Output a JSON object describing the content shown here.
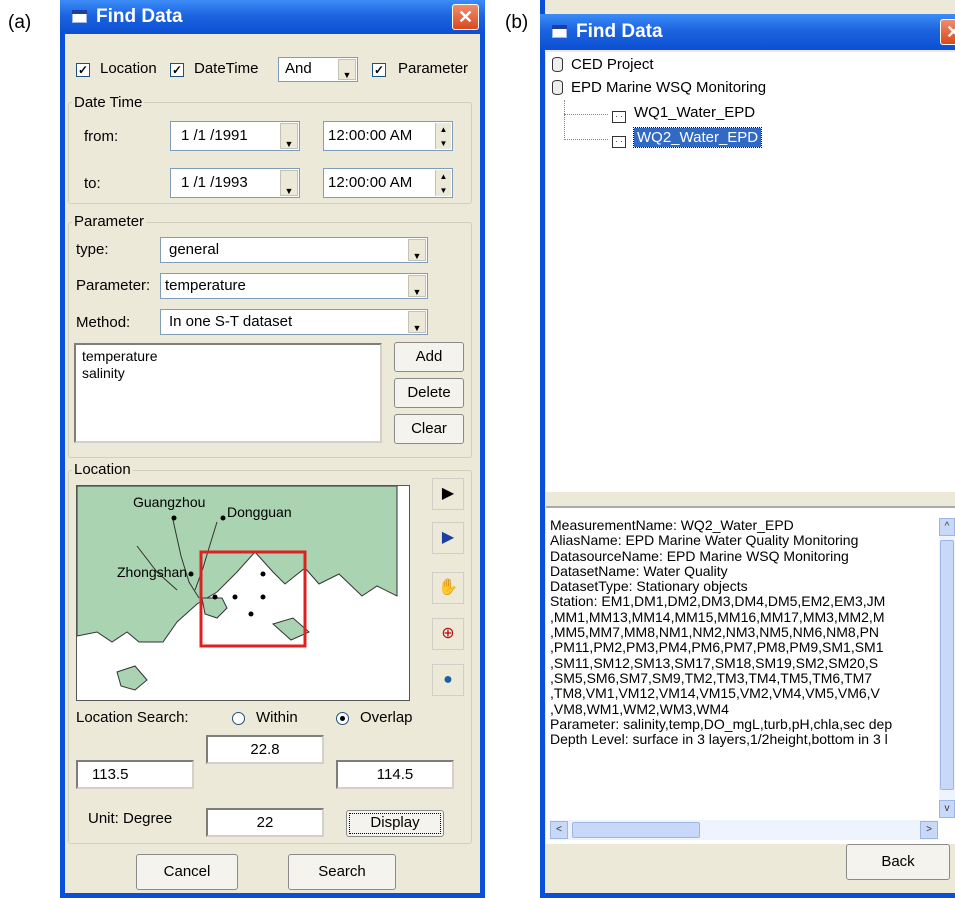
{
  "labels": {
    "a": "(a)",
    "b": "(b)"
  },
  "colors": {
    "title_blue": "#0b4fd2",
    "selection": "#316ac5",
    "map_land": "#a9d3b1",
    "search_box": "#e02020"
  },
  "left_window": {
    "title": "Find Data",
    "filter": {
      "location_label": "Location",
      "location_checked": true,
      "datetime_label": "DateTime",
      "datetime_checked": true,
      "logic_value": "And",
      "parameter_label": "Parameter",
      "parameter_checked": true
    },
    "date_time": {
      "legend": "Date Time",
      "from_label": "from:",
      "from_date": "1 /1 /1991",
      "from_time": "12:00:00 AM",
      "to_label": "to:",
      "to_date": "1 /1 /1993",
      "to_time": "12:00:00 AM"
    },
    "parameter": {
      "legend": "Parameter",
      "type_label": "type:",
      "type_value": "general",
      "parameter_label": "Parameter:",
      "parameter_value": "temperature",
      "method_label": "Method:",
      "method_value": "In one S-T dataset",
      "list": [
        "temperature",
        "salinity"
      ],
      "add_label": "Add",
      "delete_label": "Delete",
      "clear_label": "Clear"
    },
    "location": {
      "legend": "Location",
      "map_labels": {
        "guangzhou": "Guangzhou",
        "dongguan": "Dongguan",
        "zhongshan": "Zhongshan"
      },
      "tools": [
        "select-arrow-icon",
        "select-region-icon",
        "pan-hand-icon",
        "zoom-icon",
        "globe-icon"
      ],
      "search_label": "Location Search:",
      "within_label": "Within",
      "overlap_label": "Overlap",
      "selected_mode": "Overlap",
      "top": "22.8",
      "left": "113.5",
      "right": "114.5",
      "unit_label": "Unit: Degree",
      "unit_value": "22",
      "display_label": "Display"
    },
    "cancel_label": "Cancel",
    "search_label": "Search"
  },
  "right_window": {
    "title": "Find Data",
    "tree": {
      "nodes": [
        "CED Project",
        "EPD Marine WSQ Monitoring"
      ],
      "children": [
        "WQ1_Water_EPD",
        "WQ2_Water_EPD"
      ],
      "selected": "WQ2_Water_EPD"
    },
    "info_lines": [
      "MeasurementName: WQ2_Water_EPD",
      "AliasName: EPD Marine Water Quality Monitoring",
      "DatasourceName: EPD Marine WSQ Monitoring",
      "DatasetName: Water Quality",
      "DatasetType: Stationary objects",
      "Station: EM1,DM1,DM2,DM3,DM4,DM5,EM2,EM3,JM",
      " ,MM1,MM13,MM14,MM15,MM16,MM17,MM3,MM2,M",
      " ,MM5,MM7,MM8,NM1,NM2,NM3,NM5,NM6,NM8,PN",
      " ,PM11,PM2,PM3,PM4,PM6,PM7,PM8,PM9,SM1,SM1",
      " ,SM11,SM12,SM13,SM17,SM18,SM19,SM2,SM20,S",
      " ,SM5,SM6,SM7,SM9,TM2,TM3,TM4,TM5,TM6,TM7",
      " ,TM8,VM1,VM12,VM14,VM15,VM2,VM4,VM5,VM6,V",
      " ,VM8,WM1,WM2,WM3,WM4",
      "Parameter: salinity,temp,DO_mgL,turb,pH,chla,sec dep",
      "Depth Level: surface in 3 layers,1/2height,bottom in 3 l"
    ],
    "back_label": "Back"
  }
}
